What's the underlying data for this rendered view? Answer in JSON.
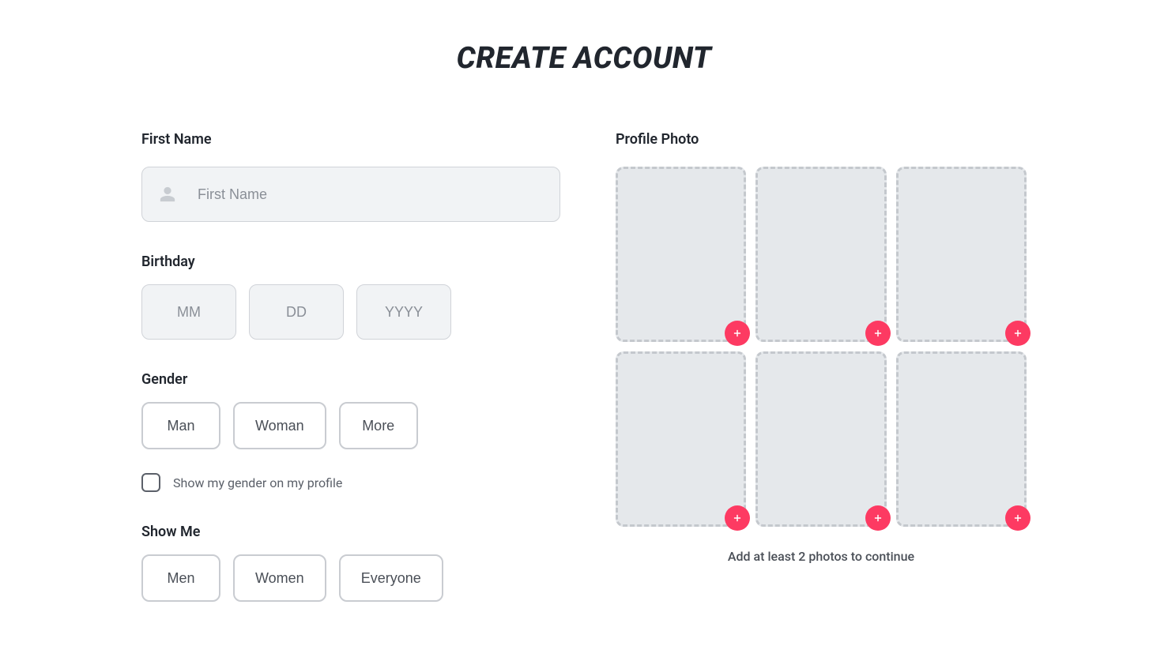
{
  "title": "CREATE ACCOUNT",
  "left": {
    "firstName": {
      "label": "First Name",
      "placeholder": "First Name",
      "value": ""
    },
    "birthday": {
      "label": "Birthday",
      "mm": {
        "placeholder": "MM",
        "value": ""
      },
      "dd": {
        "placeholder": "DD",
        "value": ""
      },
      "yyyy": {
        "placeholder": "YYYY",
        "value": ""
      }
    },
    "gender": {
      "label": "Gender",
      "options": [
        "Man",
        "Woman",
        "More"
      ],
      "showOnProfileLabel": "Show my gender on my profile",
      "showOnProfileChecked": false
    },
    "showMe": {
      "label": "Show Me",
      "options": [
        "Men",
        "Women",
        "Everyone"
      ]
    }
  },
  "right": {
    "label": "Profile Photo",
    "slots": 6,
    "hint": "Add at least 2 photos to continue"
  },
  "colors": {
    "accent": "#fd3a62",
    "inputBg": "#f1f3f5",
    "border": "#d0d3d8",
    "slotBg": "#e5e8eb",
    "slotBorder": "#c4c8cd"
  }
}
